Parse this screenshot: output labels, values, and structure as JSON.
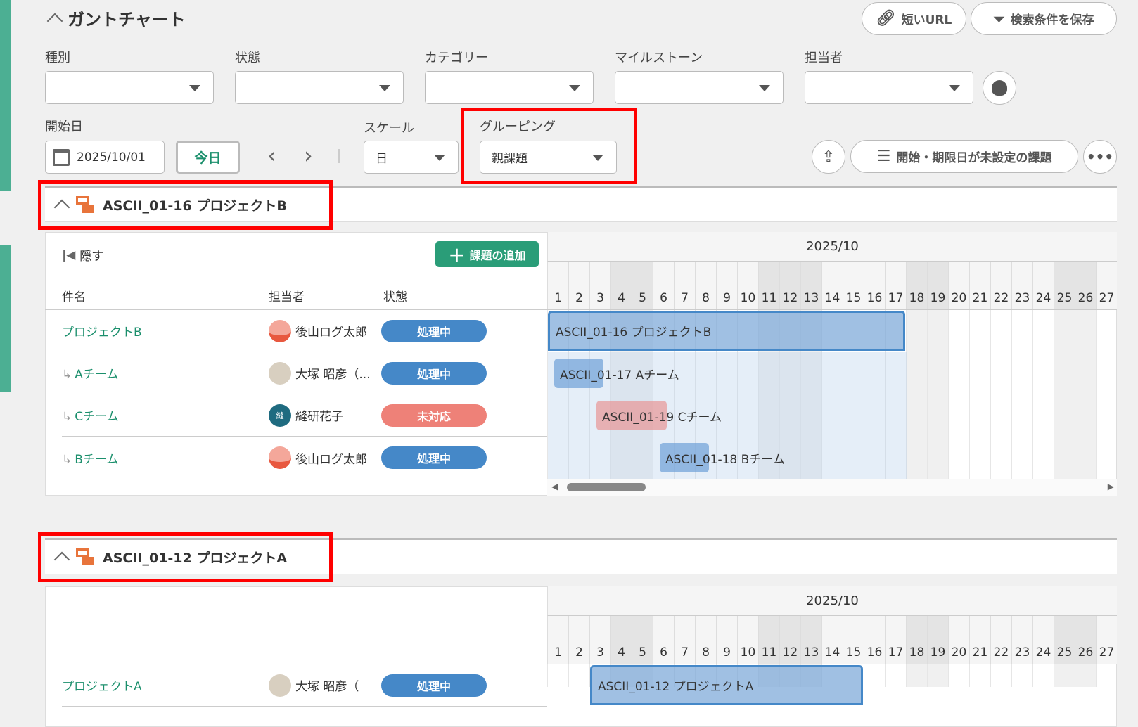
{
  "header": {
    "title": "ガントチャート",
    "short_url": "短いURL",
    "save_search": "検索条件を保存"
  },
  "filters": {
    "type_label": "種別",
    "status_label": "状態",
    "category_label": "カテゴリー",
    "milestone_label": "マイルストーン",
    "assignee_label": "担当者",
    "start_label": "開始日",
    "start_value": "2025/10/01",
    "today": "今日",
    "scale_label": "スケール",
    "scale_value": "日",
    "grouping_label": "グルーピング",
    "grouping_value": "親課題",
    "unscheduled": "開始・期限日が未設定の課題"
  },
  "groups": [
    {
      "title": "ASCII_01-16 プロジェクトB",
      "hide": "隠す",
      "add_issue": "課題の追加",
      "col_name": "件名",
      "col_assignee": "担当者",
      "col_status": "状態",
      "month": "2025/10",
      "rows": [
        {
          "name": "プロジェクトB",
          "child": false,
          "assignee": "後山ログ太郎",
          "status": "処理中",
          "bar": "ASCII_01-16  プロジェクトB",
          "start": 1,
          "end": 17
        },
        {
          "name": "Aチーム",
          "child": true,
          "assignee": "大塚 昭彦（...",
          "status": "処理中",
          "bar": "ASCII_01-17  Aチーム",
          "start": 1,
          "end": 3
        },
        {
          "name": "Cチーム",
          "child": true,
          "assignee": "縫研花子",
          "status": "未対応",
          "bar": "ASCII_01-19  Cチーム",
          "start": 3,
          "end": 6
        },
        {
          "name": "Bチーム",
          "child": true,
          "assignee": "後山ログ太郎",
          "status": "処理中",
          "bar": "ASCII_01-18  Bチーム",
          "start": 6,
          "end": 8
        }
      ]
    },
    {
      "title": "ASCII_01-12 プロジェクトA",
      "month": "2025/10",
      "rows": [
        {
          "name": "プロジェクトA",
          "child": false,
          "assignee": "大塚 昭彦（",
          "status": "処理中",
          "bar": "ASCII_01-12  プロジェクトA",
          "start": 3,
          "end": 15
        }
      ]
    }
  ],
  "avatar_initial": "縫",
  "days": [
    1,
    2,
    3,
    4,
    5,
    6,
    7,
    8,
    9,
    10,
    11,
    12,
    13,
    14,
    15,
    16,
    17,
    18,
    19,
    20,
    21,
    22,
    23,
    24,
    25,
    26,
    27
  ],
  "weekend_days": [
    4,
    5,
    11,
    12,
    13,
    18,
    19,
    25,
    26
  ],
  "colors": {
    "accent": "#2a9d78",
    "in_progress": "#4588c8",
    "open": "#ee8178"
  }
}
